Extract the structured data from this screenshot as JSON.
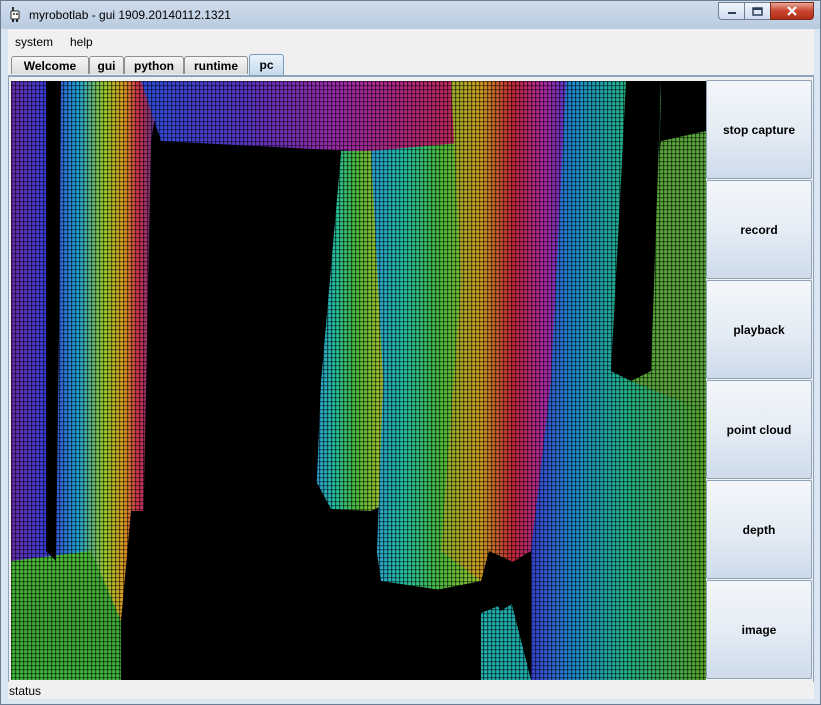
{
  "window": {
    "title": "myrobotlab - gui 1909.20140112.1321",
    "icon": "robot-app-icon",
    "controls": [
      "minimize-icon",
      "maximize-icon",
      "close-icon"
    ]
  },
  "menu": {
    "items": [
      {
        "label": "system"
      },
      {
        "label": "help"
      }
    ]
  },
  "tabs": {
    "items": [
      {
        "label": "Welcome"
      },
      {
        "label": "gui"
      },
      {
        "label": "python"
      },
      {
        "label": "runtime"
      },
      {
        "label": "pc"
      }
    ],
    "selected": "pc"
  },
  "buttons": {
    "items": [
      {
        "label": "stop capture"
      },
      {
        "label": "record"
      },
      {
        "label": "playback"
      },
      {
        "label": "point cloud"
      },
      {
        "label": "depth"
      },
      {
        "label": "image"
      }
    ]
  },
  "view": {
    "content": "point-cloud-depth-rendering",
    "palette": [
      "#7b2fb8",
      "#3b3fe0",
      "#1fa8d8",
      "#27c79a",
      "#4dbf3a",
      "#9ccf2e",
      "#e0c020",
      "#d86a20",
      "#c8284a",
      "#c02ea0"
    ]
  },
  "status": {
    "text": "status"
  }
}
